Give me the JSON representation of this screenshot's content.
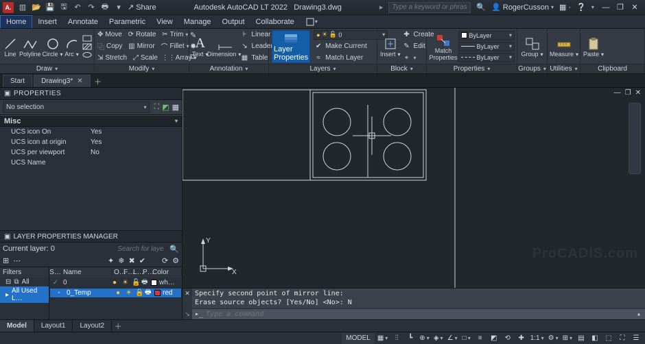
{
  "title": {
    "app": "Autodesk AutoCAD LT 2022",
    "file": "Drawing3.dwg",
    "logo": "A."
  },
  "qat_share": "Share",
  "search_placeholder": "Type a keyword or phrase",
  "user": "RogerCusson",
  "menus": [
    "Home",
    "Insert",
    "Annotate",
    "Parametric",
    "View",
    "Manage",
    "Output",
    "Collaborate"
  ],
  "menu_active": 0,
  "ribbon": {
    "draw": {
      "title": "Draw",
      "items": [
        "Line",
        "Polyline",
        "Circle",
        "Arc"
      ]
    },
    "modify": {
      "title": "Modify",
      "rows": [
        [
          "Move",
          "Rotate",
          "Trim"
        ],
        [
          "Copy",
          "Mirror",
          "Fillet"
        ],
        [
          "Stretch",
          "Scale",
          "Array"
        ]
      ]
    },
    "annotation": {
      "title": "Annotation",
      "text": "Text",
      "dim": "Dimension",
      "items": [
        "Linear",
        "Leader",
        "Table"
      ]
    },
    "layers": {
      "title": "Layers",
      "btn": "Layer\nProperties",
      "items": [
        "Make Current",
        "Match Layer"
      ]
    },
    "block": {
      "title": "Block",
      "insert": "Insert",
      "items": [
        "Create",
        "Edit"
      ]
    },
    "properties": {
      "title": "Properties",
      "match": "Match\nProperties",
      "bylayer": "ByLayer"
    },
    "groups": {
      "title": "Groups",
      "btn": "Group"
    },
    "utilities": {
      "title": "Utilities",
      "btn": "Measure"
    },
    "clipboard": {
      "title": "Clipboard",
      "btn": "Paste"
    }
  },
  "filetabs": [
    {
      "label": "Start",
      "active": false,
      "closable": false
    },
    {
      "label": "Drawing3*",
      "active": true,
      "closable": true
    }
  ],
  "properties": {
    "title": "PROPERTIES",
    "selection": "No selection",
    "category": "Misc",
    "rows": [
      {
        "k": "UCS icon On",
        "v": "Yes"
      },
      {
        "k": "UCS icon at origin",
        "v": "Yes"
      },
      {
        "k": "UCS per viewport",
        "v": "No"
      },
      {
        "k": "UCS Name",
        "v": ""
      }
    ]
  },
  "lpm": {
    "title": "LAYER PROPERTIES MANAGER",
    "current": "Current layer: 0",
    "search_ph": "Search for layer",
    "filters_label": "Filters",
    "filter_sub": "All Used L…",
    "filter_all": "All",
    "headers": [
      "S…",
      "Name",
      "O…",
      "F…",
      "L…",
      "P…",
      "Color"
    ],
    "layers": [
      {
        "status": "✓",
        "name": "0",
        "on": true,
        "freeze": false,
        "lock": false,
        "plot": true,
        "color": "#ffffff",
        "colname": "wh…",
        "sel": false
      },
      {
        "status": "▪",
        "name": "0_Temp",
        "on": true,
        "freeze": false,
        "lock": false,
        "plot": true,
        "color": "#d23b3b",
        "colname": "red",
        "sel": true
      }
    ]
  },
  "cmd": {
    "hist": [
      "Specify second point of mirror line:",
      "Erase source objects? [Yes/No] <No>: N"
    ],
    "placeholder": "Type a command"
  },
  "layouts": [
    "Model",
    "Layout1",
    "Layout2"
  ],
  "layout_active": 0,
  "status": {
    "left": "MODEL",
    "scale": "1:1"
  },
  "watermark": "ProCADIS.com",
  "ucs": {
    "x": "X",
    "y": "Y"
  }
}
